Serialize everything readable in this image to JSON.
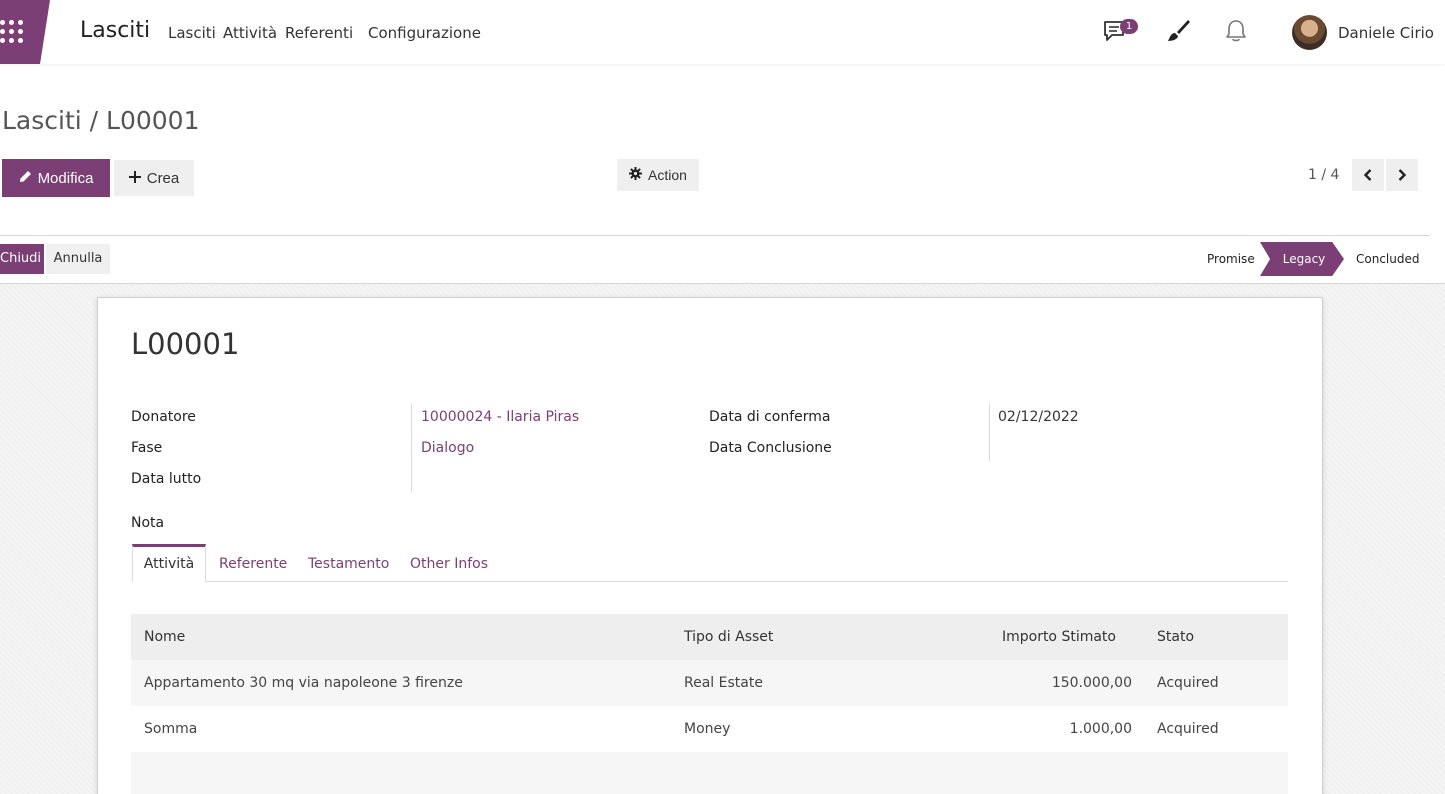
{
  "navbar": {
    "brand": "Lasciti",
    "menu": [
      "Lasciti",
      "Attività",
      "Referenti",
      "Configurazione"
    ],
    "messages_count": "1",
    "user_name": "Daniele Cirio"
  },
  "control_panel": {
    "breadcrumb": "Lasciti / L00001",
    "edit_label": "Modifica",
    "create_label": "Crea",
    "action_label": "Action",
    "pager": "1 / 4"
  },
  "statusbar": {
    "close_label": "Chiudi",
    "cancel_label": "Annulla",
    "stages": [
      "Promise",
      "Legacy",
      "Concluded"
    ],
    "active_stage": "Legacy"
  },
  "record": {
    "title": "L00001",
    "fields": {
      "donatore_label": "Donatore",
      "donatore_value": "10000024 - Ilaria Piras",
      "fase_label": "Fase",
      "fase_value": "Dialogo",
      "data_lutto_label": "Data lutto",
      "data_conferma_label": "Data di conferma",
      "data_conferma_value": "02/12/2022",
      "data_conclusione_label": "Data Conclusione",
      "nota_label": "Nota"
    }
  },
  "tabs": [
    "Attività",
    "Referente",
    "Testamento",
    "Other Infos"
  ],
  "table": {
    "headers": [
      "Nome",
      "Tipo di Asset",
      "Importo Stimato",
      "Stato"
    ],
    "rows": [
      [
        "Appartamento 30 mq via napoleone 3 firenze",
        "Real Estate",
        "150.000,00",
        "Acquired"
      ],
      [
        "Somma",
        "Money",
        "1.000,00",
        "Acquired"
      ]
    ]
  },
  "colors": {
    "primary": "#7c3f75"
  }
}
